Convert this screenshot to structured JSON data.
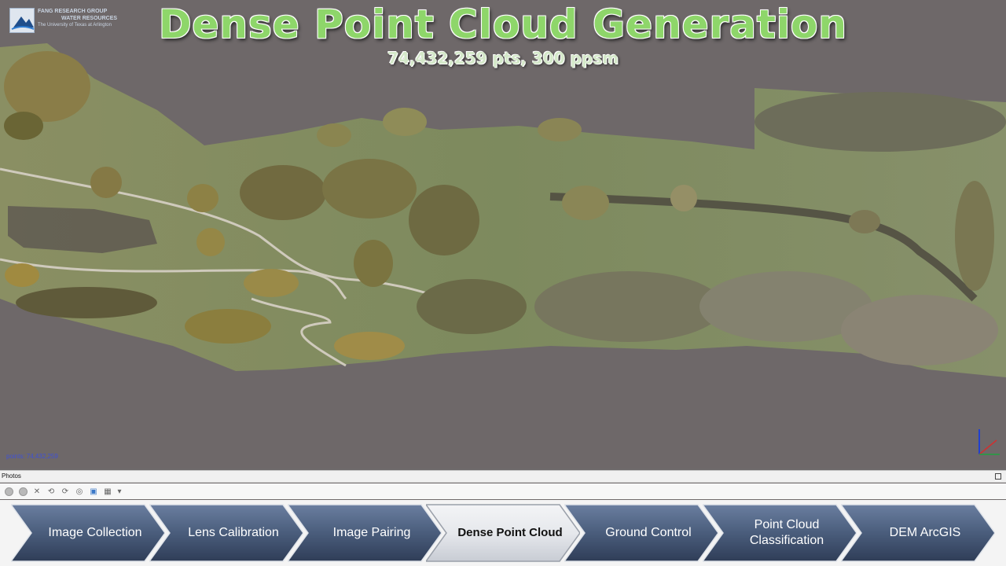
{
  "header": {
    "title": "Dense Point Cloud Generation",
    "subtitle": "74,432,259 pts, 300 ppsm"
  },
  "logo": {
    "line1": "FANG RESEARCH GROUP",
    "line2": "WATER RESOURCES",
    "line3": "The University of Texas at Arlington"
  },
  "viewport": {
    "points_readout": "points: 74,432,259",
    "axes_icon": "xyz-axes-icon"
  },
  "photos_panel": {
    "label": "Photos",
    "toolbar_icons": [
      "circle-icon",
      "remove-icon",
      "close-icon",
      "rotate-left-icon",
      "rotate-right-icon",
      "binoculars-icon",
      "select-icon",
      "grid-view-icon",
      "dropdown-arrow-icon"
    ]
  },
  "workflow": {
    "active_index": 3,
    "colors": {
      "step": "#4a5d7c",
      "step_dark": "#2f3d57",
      "active": "#e6e8ec"
    },
    "steps": [
      {
        "label": "Image Collection"
      },
      {
        "label": "Lens Calibration"
      },
      {
        "label": "Image Pairing"
      },
      {
        "label": "Dense Point Cloud"
      },
      {
        "label": "Ground Control"
      },
      {
        "label": "Point Cloud Classification"
      },
      {
        "label": "DEM ArcGIS"
      }
    ]
  }
}
